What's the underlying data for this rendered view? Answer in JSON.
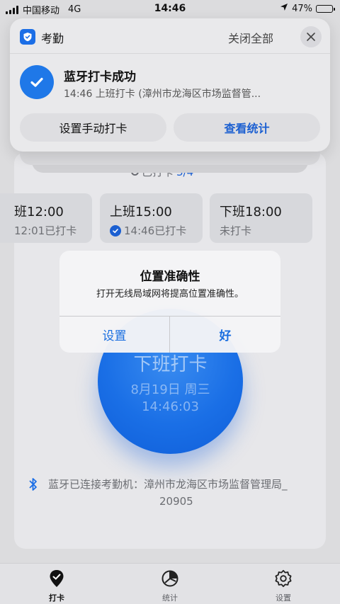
{
  "status_bar": {
    "carrier": "中国移动",
    "network": "4G",
    "time": "14:46",
    "battery": "47%",
    "battery_level": 0.47
  },
  "notification": {
    "app_name": "考勤",
    "close_all": "关闭全部",
    "title": "蓝牙打卡成功",
    "body": "14:46 上班打卡 (漳州市龙海区市场监督管...",
    "buttons": {
      "manual": "设置手动打卡",
      "stats": "查看统计"
    }
  },
  "punch_summary": {
    "prefix": "已打卡",
    "count": "3/4"
  },
  "shifts": [
    {
      "time": "班12:00",
      "status": "12:01已打卡"
    },
    {
      "time": "上班15:00",
      "status": "14:46已打卡"
    },
    {
      "time": "下班18:00",
      "status": "未打卡"
    }
  ],
  "punch_button": {
    "label": "下班打卡",
    "date": "8月19日 周三",
    "time": "14:46:03"
  },
  "bluetooth": {
    "line1": "蓝牙已连接考勤机：漳州市龙海区市场监督管理局_",
    "line2": "20905"
  },
  "alert": {
    "title": "位置准确性",
    "message": "打开无线局域网将提高位置准确性。",
    "settings_label": "设置",
    "ok_label": "好"
  },
  "tabs": [
    {
      "label": "打卡",
      "icon": "punch-icon",
      "active": true
    },
    {
      "label": "统计",
      "icon": "chart-icon",
      "active": false
    },
    {
      "label": "设置",
      "icon": "gear-icon",
      "active": false
    }
  ],
  "colors": {
    "accent": "#1b6ee6",
    "background": "#dcdcde"
  }
}
